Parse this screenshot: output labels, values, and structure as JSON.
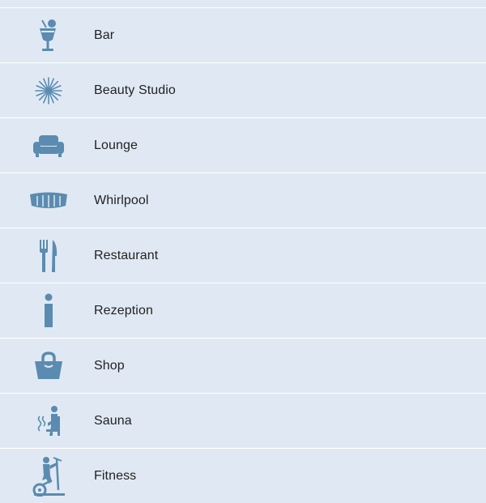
{
  "accent_color": "#5b8bb0",
  "amenities": [
    {
      "label": "Bar",
      "icon": "cocktail-icon"
    },
    {
      "label": "Beauty Studio",
      "icon": "starburst-icon"
    },
    {
      "label": "Lounge",
      "icon": "armchair-icon"
    },
    {
      "label": "Whirlpool",
      "icon": "hot-tub-icon"
    },
    {
      "label": "Restaurant",
      "icon": "fork-knife-icon"
    },
    {
      "label": "Rezeption",
      "icon": "info-icon"
    },
    {
      "label": "Shop",
      "icon": "shopping-bag-icon"
    },
    {
      "label": "Sauna",
      "icon": "sauna-person-icon"
    },
    {
      "label": "Fitness",
      "icon": "exercise-bike-icon"
    }
  ]
}
